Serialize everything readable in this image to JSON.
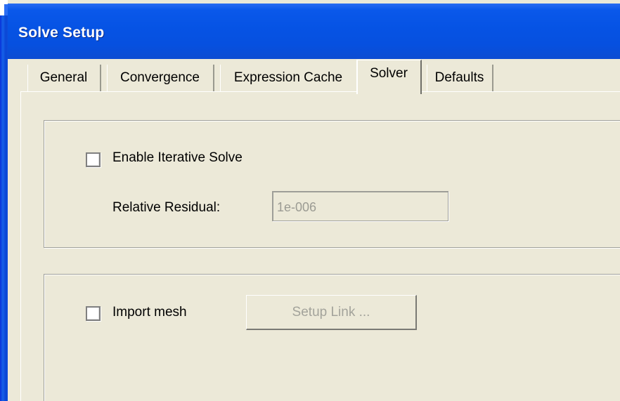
{
  "window": {
    "title": "Solve Setup"
  },
  "tabs": [
    {
      "label": "General"
    },
    {
      "label": "Convergence"
    },
    {
      "label": "Expression Cache"
    },
    {
      "label": "Solver",
      "active": true
    },
    {
      "label": "Defaults"
    }
  ],
  "solver": {
    "iterative": {
      "checkbox_label": "Enable Iterative Solve",
      "checked": false,
      "residual_label": "Relative Residual:",
      "residual_value": "1e-006",
      "residual_enabled": false
    },
    "mesh": {
      "checkbox_label": "Import mesh",
      "checked": false,
      "setup_link_label": "Setup Link ...",
      "setup_link_enabled": false
    }
  }
}
